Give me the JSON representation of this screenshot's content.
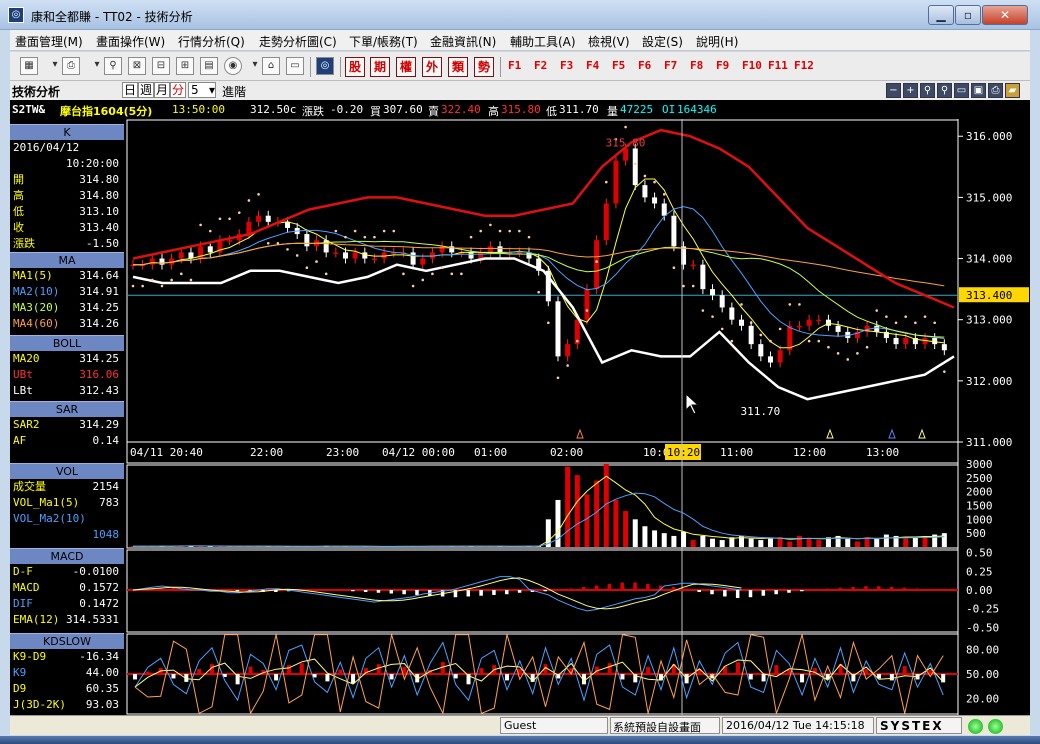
{
  "window": {
    "title": "康和全都賺 - TT02 - 技術分析",
    "min_icon": "minimize-icon",
    "max_icon": "maximize-icon",
    "close_icon": "close-icon"
  },
  "menu": [
    "畫面管理(M)",
    "畫面操作(W)",
    "行情分析(Q)",
    "走勢分析圖(C)",
    "下單/帳務(T)",
    "金融資訊(N)",
    "輔助工具(A)",
    "檢視(V)",
    "設定(S)",
    "說明(H)"
  ],
  "toolbar": {
    "buttons": [
      "股",
      "期",
      "權",
      "外",
      "類",
      "勢"
    ],
    "fkeys": [
      "F1",
      "F2",
      "F3",
      "F4",
      "F5",
      "F6",
      "F7",
      "F8",
      "F9",
      "F10",
      "F11",
      "F12"
    ]
  },
  "header": {
    "title": "技術分析",
    "periods": [
      "日",
      "週",
      "月",
      "分"
    ],
    "selected_period": "分",
    "interval": "5",
    "advanced": "進階"
  },
  "quote": {
    "symbol": "S2TW&",
    "name": "摩台指1604(5分)",
    "time": "13:50:00",
    "close": "312.50c",
    "change_label": "漲跌",
    "change": "-0.20",
    "buy_label": "買",
    "buy": "307.60",
    "sell_label": "賣",
    "sell": "322.40",
    "high_label": "高",
    "high": "315.80",
    "low_label": "低",
    "low": "311.70",
    "vol_label": "量",
    "vol": "47225",
    "oi_label": "OI",
    "oi": "164346"
  },
  "sidepanel": {
    "k": {
      "header": "K",
      "date": "2016/04/12",
      "time": "10:20:00",
      "rows": [
        {
          "label": "開",
          "value": "314.80"
        },
        {
          "label": "高",
          "value": "314.80"
        },
        {
          "label": "低",
          "value": "313.10"
        },
        {
          "label": "收",
          "value": "313.40"
        },
        {
          "label": "漲跌",
          "value": "-1.50"
        }
      ]
    },
    "ma": {
      "header": "MA",
      "rows": [
        {
          "label": "MA1(5)",
          "value": "314.64"
        },
        {
          "label": "MA2(10)",
          "value": "314.91"
        },
        {
          "label": "MA3(20)",
          "value": "314.25"
        },
        {
          "label": "MA4(60)",
          "value": "314.26"
        }
      ]
    },
    "boll": {
      "header": "BOLL",
      "rows": [
        {
          "label": "MA20",
          "value": "314.25"
        },
        {
          "label": "UBt",
          "value": "316.06"
        },
        {
          "label": "LBt",
          "value": "312.43"
        }
      ]
    },
    "sar": {
      "header": "SAR",
      "rows": [
        {
          "label": "SAR2",
          "value": "314.29"
        },
        {
          "label": "AF",
          "value": "0.14"
        }
      ]
    },
    "vol": {
      "header": "VOL",
      "rows": [
        {
          "label": "成交量",
          "value": "2154"
        },
        {
          "label": "VOL_Ma1(5)",
          "value": "783"
        },
        {
          "label": "VOL_Ma2(10)",
          "value": ""
        },
        {
          "label": "",
          "value": "1048"
        }
      ]
    },
    "macd": {
      "header": "MACD",
      "rows": [
        {
          "label": "D-F",
          "value": "-0.0100"
        },
        {
          "label": "MACD",
          "value": "0.1572"
        },
        {
          "label": "DIF",
          "value": "0.1472"
        },
        {
          "label": "EMA(12)",
          "value": "314.5331"
        }
      ]
    },
    "kd": {
      "header": "KDSLOW",
      "rows": [
        {
          "label": "K9-D9",
          "value": "-16.34"
        },
        {
          "label": "K9",
          "value": "44.00"
        },
        {
          "label": "D9",
          "value": "60.35"
        },
        {
          "label": "J(3D-2K)",
          "value": "93.03"
        }
      ]
    }
  },
  "chart_data": {
    "type": "candlestick",
    "price_axis": [
      "316.000",
      "315.000",
      "314.000",
      "313.000",
      "312.000",
      "311.000"
    ],
    "price_ylim": [
      311.0,
      316.2
    ],
    "current_price": "313.400",
    "time_axis": [
      "04/11 20:40",
      "22:00",
      "23:00",
      "04/12 00:00",
      "01:00",
      "02:00",
      "10:00",
      "10:20",
      "11:00",
      "12:00",
      "13:00"
    ],
    "annotations": {
      "high": "315.80",
      "low": "311.70"
    },
    "closes": [
      313.9,
      313.9,
      314.0,
      313.9,
      314.0,
      314.1,
      314.0,
      314.2,
      314.1,
      314.3,
      314.3,
      314.4,
      314.6,
      314.7,
      314.6,
      314.6,
      314.5,
      314.4,
      314.2,
      314.3,
      314.1,
      314.1,
      314.0,
      314.1,
      314.0,
      314.0,
      314.1,
      314.1,
      314.1,
      313.9,
      314.0,
      314.1,
      314.2,
      314.1,
      314.1,
      314.0,
      314.1,
      314.2,
      314.1,
      314.1,
      314.1,
      314.0,
      313.8,
      313.3,
      312.4,
      312.6,
      313.0,
      313.5,
      314.3,
      314.9,
      315.6,
      315.8,
      315.2,
      315.0,
      314.9,
      314.7,
      314.2,
      313.9,
      313.9,
      313.5,
      313.4,
      313.2,
      313.0,
      312.9,
      312.6,
      312.4,
      312.3,
      312.5,
      312.9,
      312.9,
      313.0,
      313.0,
      312.9,
      312.8,
      312.7,
      312.8,
      312.9,
      312.8,
      312.7,
      312.6,
      312.7,
      312.6,
      312.7,
      312.6,
      312.5
    ],
    "boll_upper": [
      314.0,
      314.1,
      314.2,
      314.3,
      314.4,
      314.6,
      314.8,
      314.9,
      315.0,
      315.0,
      314.9,
      314.8,
      314.7,
      314.7,
      314.8,
      314.9,
      315.5,
      315.9,
      316.1,
      316.0,
      315.8,
      315.5,
      315.0,
      314.5,
      314.2,
      313.9,
      313.6,
      313.4,
      313.2
    ],
    "boll_lower": [
      313.7,
      313.6,
      313.6,
      313.6,
      313.8,
      313.8,
      313.7,
      313.6,
      313.7,
      313.9,
      313.8,
      313.9,
      314.0,
      314.0,
      313.8,
      313.2,
      312.3,
      312.5,
      312.4,
      312.4,
      312.8,
      312.3,
      311.9,
      311.7,
      311.8,
      311.9,
      312.0,
      312.1,
      312.4
    ],
    "volume_axis": [
      "3000",
      "2500",
      "2000",
      "1500",
      "1000",
      "500"
    ],
    "volume": [
      30,
      20,
      25,
      40,
      30,
      60,
      40,
      30,
      25,
      30,
      20,
      25,
      30,
      20,
      25,
      20,
      15,
      20,
      25,
      20,
      40,
      25,
      20,
      15,
      20,
      25,
      15,
      20,
      20,
      30,
      25,
      30,
      20,
      25,
      30,
      25,
      20,
      25,
      20,
      25,
      20,
      30,
      30,
      1000,
      1700,
      2900,
      2600,
      1900,
      2400,
      3000,
      1700,
      1300,
      1000,
      750,
      600,
      500,
      400,
      550,
      250,
      400,
      300,
      250,
      350,
      400,
      300,
      250,
      300,
      350,
      200,
      400,
      300,
      250,
      350,
      400,
      300,
      200,
      350,
      300,
      450,
      400,
      300,
      350,
      400,
      450,
      500
    ],
    "macd_axis": [
      "0.50",
      "0.25",
      "0.00",
      "-0.25",
      "-0.50"
    ],
    "macd_hist": [
      0.0,
      0.01,
      0.02,
      0.03,
      0.02,
      0.01,
      0.0,
      0.0,
      -0.01,
      -0.01,
      -0.02,
      -0.02,
      -0.01,
      0.0,
      0.01,
      0.01,
      0.0,
      -0.01,
      -0.02,
      -0.03,
      -0.04,
      -0.05,
      -0.06,
      -0.07,
      -0.08,
      -0.09,
      -0.08,
      -0.07,
      -0.06,
      -0.05,
      -0.03,
      -0.02,
      -0.01,
      0.0,
      0.02,
      0.04,
      0.06,
      0.08,
      0.1,
      0.1,
      0.08,
      0.06,
      0.04,
      0.02,
      -0.02,
      -0.05,
      -0.08,
      -0.1,
      -0.09,
      -0.07,
      -0.05,
      -0.03,
      -0.01,
      0.0,
      0.02,
      0.03,
      0.04,
      0.05,
      0.05,
      0.04,
      0.03,
      0.02,
      0.01,
      0.0
    ],
    "kd_axis": [
      "80.00",
      "50.00",
      "20.00"
    ],
    "kd_hist": [
      -10,
      5,
      12,
      -8,
      -15,
      10,
      20,
      -5,
      -20,
      15,
      8,
      -12,
      18,
      22,
      -6,
      -14,
      9,
      -18,
      12,
      20,
      -10,
      14,
      -16,
      8,
      24,
      -8,
      -20,
      12,
      18,
      -12,
      10,
      -15,
      20,
      -8,
      12,
      -20,
      15,
      22,
      -10,
      -16,
      14,
      -12,
      20,
      -18,
      10,
      -8,
      16,
      24,
      -10,
      -14,
      18,
      8,
      -16,
      12,
      -10,
      20,
      -14,
      10,
      -8,
      -12,
      16,
      -10,
      8,
      -16
    ]
  },
  "status": {
    "user": "Guest",
    "screen": "系統預設自設畫面",
    "datetime": "2016/04/12 Tue 14:15:18",
    "brand": "SYSTEX"
  }
}
